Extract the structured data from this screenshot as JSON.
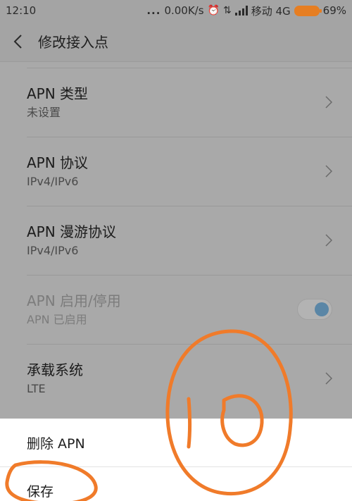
{
  "status_bar": {
    "time": "12:10",
    "dots": "...",
    "net_speed": "0.00K/s",
    "carrier": "移动 4G",
    "battery": "69%"
  },
  "header": {
    "title": "修改接入点"
  },
  "settings": [
    {
      "title": "APN 类型",
      "subtitle": "未设置",
      "control": "chevron"
    },
    {
      "title": "APN 协议",
      "subtitle": "IPv4/IPv6",
      "control": "chevron"
    },
    {
      "title": "APN 漫游协议",
      "subtitle": "IPv4/IPv6",
      "control": "chevron"
    },
    {
      "title": "APN 启用/停用",
      "subtitle": "APN 已启用",
      "control": "toggle",
      "toggle_on": true,
      "disabled": true
    },
    {
      "title": "承载系统",
      "subtitle": "LTE",
      "control": "chevron"
    }
  ],
  "actions": {
    "delete_label": "删除 APN",
    "save_label": "保存"
  },
  "colors": {
    "annotation": "#f07b2a",
    "toggle_knob": "#5a86a6",
    "battery": "#e67e22"
  }
}
